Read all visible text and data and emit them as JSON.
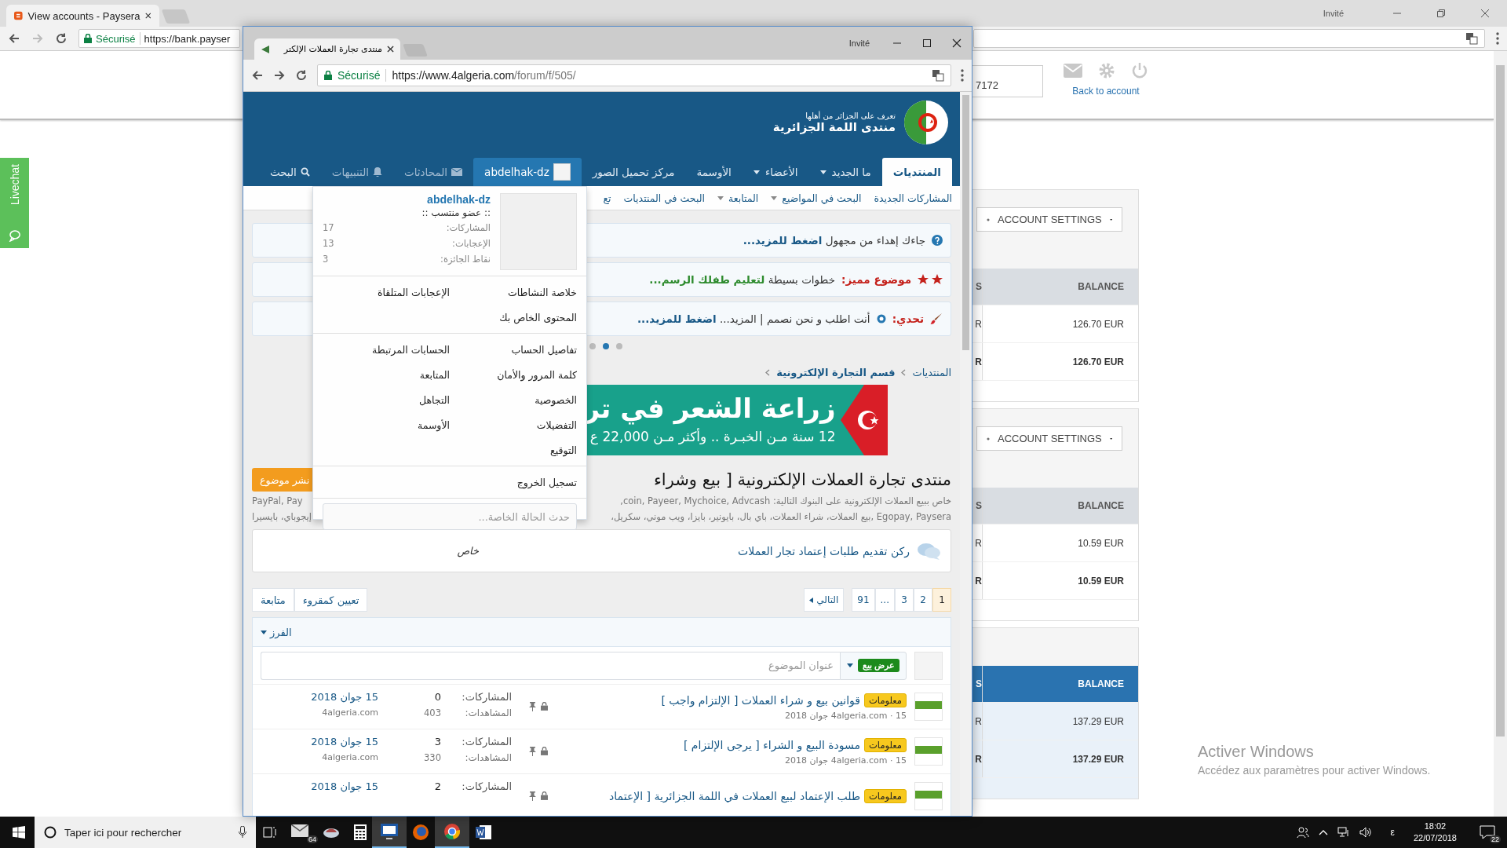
{
  "bg_browser": {
    "tab": {
      "title": "View accounts - Paysera"
    },
    "profile": "Invité",
    "security": "Sécurisé",
    "url": "https://bank.payser"
  },
  "livechat": {
    "label": "Livechat"
  },
  "bank_page": {
    "account_field": {
      "value": "7172"
    },
    "back_link": "Back to account",
    "cards": [
      {
        "settings_button": "ACCOUNT SETTINGS",
        "highlighted": false,
        "header": {
          "column_1": "S",
          "balance": "BALANCE"
        },
        "rows": [
          {
            "column_1": "R",
            "balance": "126.70 EUR",
            "bold": false
          },
          {
            "column_1": "R",
            "balance": "126.70 EUR",
            "bold": true
          }
        ]
      },
      {
        "settings_button": "ACCOUNT SETTINGS",
        "highlighted": false,
        "header": {
          "column_1": "S",
          "balance": "BALANCE"
        },
        "rows": [
          {
            "column_1": "R",
            "balance": "10.59 EUR",
            "bold": false
          },
          {
            "column_1": "R",
            "balance": "10.59 EUR",
            "bold": true
          }
        ]
      },
      {
        "highlighted": true,
        "header": {
          "column_1": "S",
          "balance": "BALANCE"
        },
        "rows": [
          {
            "column_1": "R",
            "balance": "137.29 EUR",
            "bold": false
          },
          {
            "column_1": "R",
            "balance": "137.29 EUR",
            "bold": true
          }
        ]
      }
    ]
  },
  "activation_notice": {
    "title": "Activer Windows",
    "text": "Accédez aux paramètres pour activer Windows."
  },
  "fg_browser": {
    "tab": {
      "title": "منتدى تجارة العملات الإلكتر"
    },
    "profile": "Invité",
    "security": "Sécurisé",
    "url_host": "https://www.4algeria.com",
    "url_path": "/forum/f/505/"
  },
  "forum": {
    "logo": {
      "tagline": "تعرف على الجزائر من أهلها",
      "name": "منتدى اللمة الجزائرية"
    },
    "nav_tabs": [
      {
        "label": "المنتديات",
        "selected": true,
        "dropdown": false
      },
      {
        "label": "ما الجديد",
        "selected": false,
        "dropdown": true
      },
      {
        "label": "الأعضاء",
        "selected": false,
        "dropdown": true
      },
      {
        "label": "الأوسمة",
        "selected": false,
        "dropdown": false
      },
      {
        "label": "مركز تحميل الصور",
        "selected": false,
        "dropdown": false
      }
    ],
    "user_tab": {
      "label": "abdelhak-dz",
      "selected": true
    },
    "conversations": "المحادثات",
    "alerts": "التنبيهات",
    "search": "البحث",
    "sub_nav": [
      {
        "label": "المشاركات الجديدة",
        "dropdown": false
      },
      {
        "label": "البحث في المواضيع",
        "dropdown": true
      },
      {
        "label": "المتابعة",
        "dropdown": true
      },
      {
        "label": "البحث في المنتديات",
        "dropdown": false
      },
      {
        "label": "تع",
        "dropdown": false
      }
    ],
    "notices": [
      {
        "kind": "gift",
        "text": "جاءك إهداء من مجهول",
        "link": "اضغط للمزيد..."
      },
      {
        "kind": "featured",
        "label": "موضوع مميز:",
        "text": "خطوات بسيطة",
        "link": "لتعليم طفلك الرسم..."
      },
      {
        "kind": "challenge",
        "label": "تحدي:",
        "text": "أنت اطلب و نحن نصمم | المزيد...",
        "link": "اضغط للمزيد..."
      }
    ],
    "carousel_dots": [
      {
        "selected": false
      },
      {
        "selected": true
      },
      {
        "selected": false
      }
    ],
    "breadcrumb": [
      "المنتديات",
      "قسم التجارة الإلكترونية"
    ],
    "ad": {
      "headline": "زراعة الشعر في تر",
      "subline": "12 سنة مـن الخبـرة .. وأكثر مـن 22,000 ع"
    },
    "title": "منتدى تجارة العملات الإلكترونية [ بيع وشراء",
    "post_button": "نشر موضوع",
    "description": [
      {
        "right": "خاص ببيع العملات الإلكترونية على البنوك التالية: coin, Payeer, Mychoice, Advcash,",
        "left": "PayPal, Pay"
      },
      {
        "right": "Egopay, Paysera ,بيع العملات، شراء العملات، باي بال، بايونير، بايزا، ويب موني، سكريل،",
        "left": "إيجوباي، بايسيرا"
      }
    ],
    "node": {
      "title": "ركن تقديم طلبات إعتماد تجار العملات",
      "label": "خاص"
    },
    "pagination": [
      {
        "label": "1",
        "selected": true
      },
      {
        "label": "2",
        "selected": false
      },
      {
        "label": "3",
        "selected": false
      },
      {
        "label": "...",
        "selected": false
      },
      {
        "label": "91",
        "selected": false
      }
    ],
    "next": "التالي",
    "actions": [
      "تعيين كمقروء",
      "متابعة"
    ],
    "sort": "الفرز",
    "quick_thread": {
      "prefix": "عرض بيع",
      "placeholder": "عنوان الموضوع"
    },
    "threads": [
      {
        "prefix": "معلومات",
        "title": "قوانين بيع و شراء العملات [ الإلتزام واجب ]",
        "meta": "4algeria.com · 15 جوان 2018",
        "locked": true,
        "sticky": true,
        "replies_label": "المشاركات:",
        "replies": "0",
        "views_label": "المشاهدات:",
        "views": "403",
        "last_date": "15 جوان 2018",
        "last_user": "4algeria.com"
      },
      {
        "prefix": "معلومات",
        "title": "مسودة البيع و الشراء [ يرجى الإلتزام ]",
        "meta": "4algeria.com · 15 جوان 2018",
        "locked": true,
        "sticky": true,
        "replies_label": "المشاركات:",
        "replies": "3",
        "views_label": "المشاهدات:",
        "views": "330",
        "last_date": "15 جوان 2018",
        "last_user": "4algeria.com"
      },
      {
        "prefix": "معلومات",
        "title": "طلب الإعتماد لبيع العملات في اللمة الجزائرية [ الإعتماد",
        "locked": true,
        "sticky": true,
        "replies_label": "المشاركات:",
        "replies": "2",
        "last_date": "15 جوان 2018"
      }
    ],
    "user_menu": {
      "username": "abdelhak-dz",
      "rank": ":: عضو منتسب ::",
      "stats": [
        {
          "label": "المشاركات:",
          "value": "17"
        },
        {
          "label": "الإعجابات:",
          "value": "13"
        },
        {
          "label": "نقاط الجائزة:",
          "value": "3"
        }
      ],
      "sections": [
        [
          "خلاصة النشاطات",
          "الإعجابات المتلقاة",
          "المحتوى الخاص بك"
        ],
        [
          "تفاصيل الحساب",
          "الحسابات المرتبطة",
          "كلمة المرور والأمان",
          "المتابعة",
          "الخصوصية",
          "التجاهل",
          "التفضيلات",
          "الأوسمة",
          "التوقيع"
        ],
        [
          "تسجيل الخروج"
        ]
      ],
      "status_placeholder": "حدث الحالة الخاصة..."
    }
  },
  "taskbar": {
    "search_placeholder": "Taper ici pour rechercher",
    "mail_badge": "64",
    "language": "ε",
    "time": "18:02",
    "date": "22/07/2018",
    "notifications": "22"
  }
}
